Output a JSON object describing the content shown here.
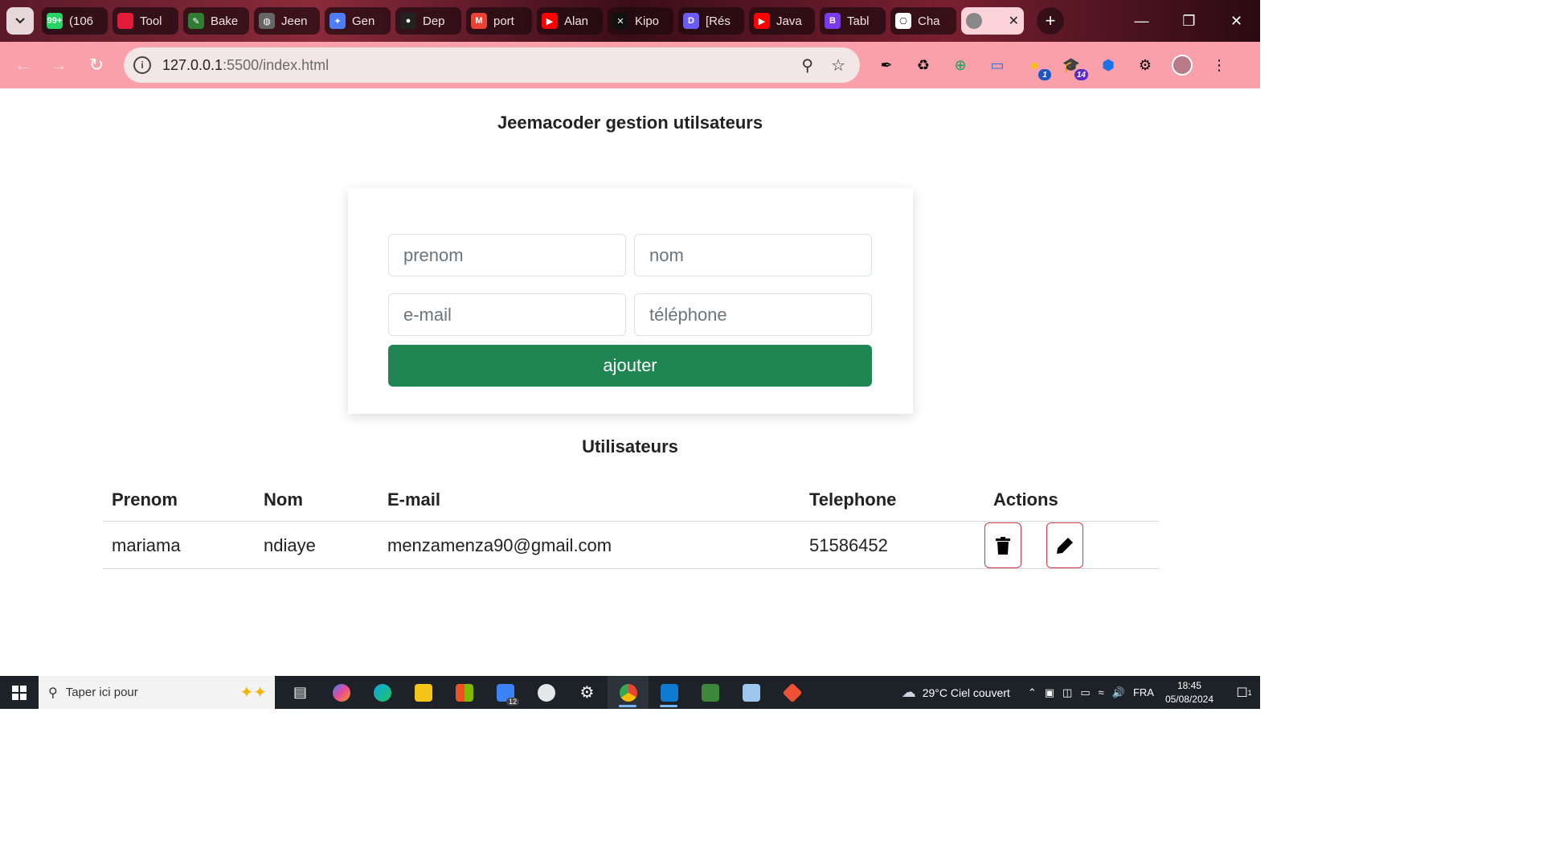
{
  "browser": {
    "tabs": [
      {
        "title": "(106",
        "favicon_color": "#25d366",
        "favicon_glyph": "99+"
      },
      {
        "title": "Tool",
        "favicon_color": "#e31b3b",
        "favicon_glyph": ""
      },
      {
        "title": "Bake",
        "favicon_color": "#2e7d32",
        "favicon_glyph": "✎"
      },
      {
        "title": "Jeen",
        "favicon_color": "#666666",
        "favicon_glyph": "◍"
      },
      {
        "title": "Gen",
        "favicon_color": "#4f7df5",
        "favicon_glyph": "✦"
      },
      {
        "title": "Dep",
        "favicon_color": "#222222",
        "favicon_glyph": "●"
      },
      {
        "title": "port",
        "favicon_color": "#ea4335",
        "favicon_glyph": "M"
      },
      {
        "title": "Alan",
        "favicon_color": "#ff0000",
        "favicon_glyph": "▶"
      },
      {
        "title": "Kipo",
        "favicon_color": "#111111",
        "favicon_glyph": "✕"
      },
      {
        "title": "[Rés",
        "favicon_color": "#6b5cf6",
        "favicon_glyph": "D"
      },
      {
        "title": "Java",
        "favicon_color": "#ff0000",
        "favicon_glyph": "▶"
      },
      {
        "title": "Tabl",
        "favicon_color": "#7c3aed",
        "favicon_glyph": "B"
      },
      {
        "title": "Cha",
        "favicon_color": "#ffffff",
        "favicon_glyph": "⎔"
      }
    ],
    "active_tab": {
      "favicon_color": "#888888",
      "close_glyph": "✕"
    },
    "url_host": "127.0.0.1",
    "url_path": ":5500/index.html",
    "extension_badges": {
      "ext1": "1",
      "ext2": "14"
    }
  },
  "page": {
    "title": "Jeemacoder gestion utilsateurs",
    "form": {
      "prenom_placeholder": "prenom",
      "nom_placeholder": "nom",
      "email_placeholder": "e-mail",
      "telephone_placeholder": "téléphone",
      "submit_label": "ajouter",
      "submit_color": "#1e8553"
    },
    "section_title": "Utilisateurs",
    "table": {
      "headers": [
        "Prenom",
        "Nom",
        "E-mail",
        "Telephone",
        "Actions"
      ],
      "rows": [
        {
          "prenom": "mariama",
          "nom": "ndiaye",
          "email": "menzamenza90@gmail.com",
          "telephone": "51586452"
        }
      ],
      "action_border_color": "#dc3545"
    }
  },
  "taskbar": {
    "search_placeholder": "Taper ici pour",
    "mail_badge": "12",
    "weather": "29°C  Ciel couvert",
    "language": "FRA",
    "time": "18:45",
    "date": "05/08/2024",
    "notification_count": "1"
  }
}
